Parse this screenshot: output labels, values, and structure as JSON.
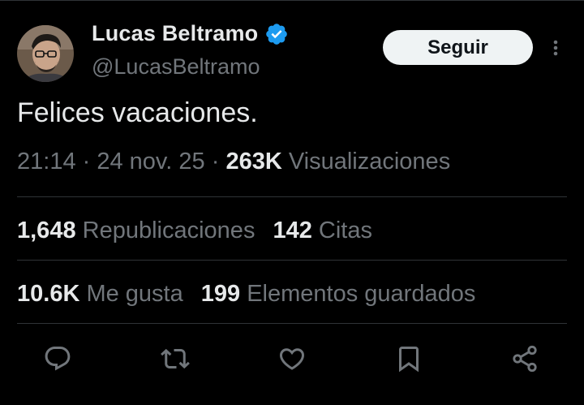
{
  "author": {
    "display_name": "Lucas Beltramo",
    "handle": "@LucasBeltramo",
    "verified": true
  },
  "follow_label": "Seguir",
  "tweet": {
    "text": "Felices vacaciones.",
    "time": "21:14",
    "date": "24 nov. 25",
    "views_count": "263K",
    "views_label": "Visualizaciones"
  },
  "stats": {
    "reposts_count": "1,648",
    "reposts_label": "Republicaciones",
    "quotes_count": "142",
    "quotes_label": "Citas",
    "likes_count": "10.6K",
    "likes_label": "Me gusta",
    "bookmarks_count": "199",
    "bookmarks_label": "Elementos guardados"
  },
  "colors": {
    "background": "#000000",
    "primary_text": "#e7e9ea",
    "secondary_text": "#71767b",
    "divider": "#2f3336",
    "verified_badge": "#1d9bf0",
    "follow_button_bg": "#eff3f4"
  },
  "icons": [
    "reply-icon",
    "repost-icon",
    "like-icon",
    "bookmark-icon",
    "share-icon",
    "more-icon",
    "verified-badge-icon"
  ]
}
